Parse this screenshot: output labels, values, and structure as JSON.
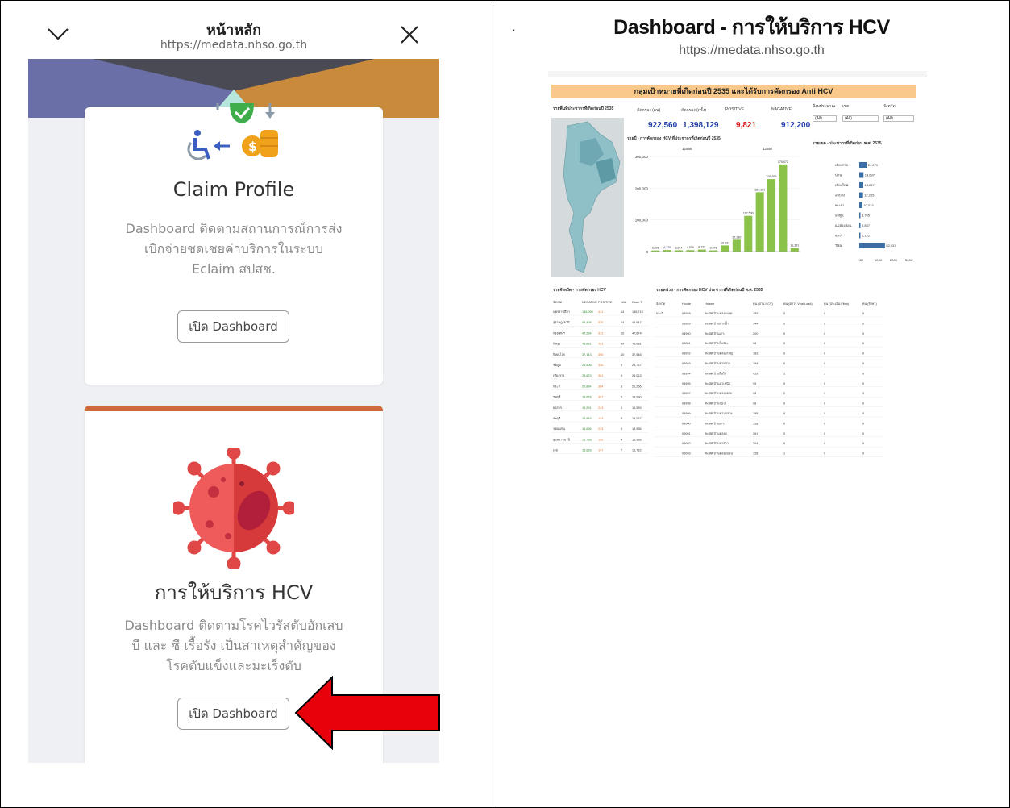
{
  "mobile": {
    "title": "หน้าหลัก",
    "url": "https://medata.nhso.go.th",
    "card1": {
      "title": "Claim Profile",
      "desc_lines": [
        "Dashboard ติดตามสถานการณ์การส่ง",
        "เบิกจ่ายชดเชยค่าบริการในระบบ",
        "Eclaim สปสช."
      ],
      "button": "เปิด Dashboard"
    },
    "card2": {
      "title": "การให้บริการ HCV",
      "desc_lines": [
        "Dashboard ติดตามโรคไวรัสตับอักเสบ",
        "บี และ ซี เรื้อรัง เป็นสาเหตุสำคัญของ",
        "โรคตับแข็งและมะเร็งตับ"
      ],
      "button": "เปิด Dashboard"
    }
  },
  "dashboard": {
    "title": "Dashboard - การให้บริการ HCV",
    "url": "https://medata.nhso.go.th",
    "banner": "กลุ่มเป้าหมายที่เกิดก่อนปี 2535 และได้รับการคัดกรอง Anti HCV",
    "kpi_labels": [
      "คัดกรอง (คน)",
      "คัดกรอง (ครั้ง)",
      "POSITIVE",
      "NAGATIVE"
    ],
    "kpi_values": [
      "922,560",
      "1,398,129",
      "9,821",
      "912,200"
    ],
    "kpi_colors": [
      "#1f3aa8",
      "#1f3aa8",
      "#d11a1a",
      "#1f3aa8"
    ],
    "map_title": "รายพื้นที่ประชากรที่เกิดก่อนปี 2535",
    "chart_title": "รายปี - การคัดกรอง HCV ที่ประชากรที่เกิดก่อนปี 2535",
    "chart_group_labels": [
      "12566",
      "12567"
    ],
    "chart_yticks": [
      "300,000",
      "200,000",
      "100,000",
      "0"
    ],
    "chart_bar_labels": [
      "3,396",
      "4,770",
      "3,964",
      "4,516",
      "6,122",
      "3,876",
      "19,337",
      "37,280",
      "112,590",
      "187,191",
      "228,565",
      "275,072",
      "11,331"
    ],
    "chart_bar_values": [
      3396,
      4770,
      3964,
      4516,
      6122,
      3876,
      19337,
      37280,
      112590,
      187191,
      228565,
      275072,
      11331
    ],
    "right_title": "รายเขต - ประชากรที่เกิดก่อน พ.ศ. 2535",
    "right_rows": [
      "เชียงราย",
      "น่าน",
      "เชียงใหม่",
      "ลำปาง",
      "พะเยา",
      "ลำพูน",
      "แม่ฮ่องสอน",
      "แพร่",
      "Total"
    ],
    "right_values": [
      "24,079",
      "13,697",
      "13,017",
      "12,215",
      "10,013",
      "3,765",
      "3,837",
      "2,116",
      "82,937"
    ],
    "right_fracs": [
      0.29,
      0.165,
      0.157,
      0.147,
      0.12,
      0.045,
      0.046,
      0.026,
      1.0
    ],
    "right_axis": [
      "0K",
      "100K",
      "200K",
      "300K"
    ],
    "filter_labels": [
      "ปีงบประมาณ",
      "เขต",
      "จังหวัด"
    ],
    "filter_value": "(All)",
    "left_table_title": "รายจังหวัด - การคัดกรอง HCV",
    "left_table_headers": [
      "จังหวัด",
      "NEGATIVE",
      "POSITIVE",
      "N/A",
      "Gran. T"
    ],
    "left_table_rows": [
      [
        "นครราชสีมา",
        "136,050",
        "411",
        "14",
        "136,715"
      ],
      [
        "สุราษฎร์ธานี",
        "49,408",
        "525",
        "14",
        "49,947"
      ],
      [
        "กรุงเทพฯ",
        "47,284",
        "312",
        "10",
        "47,674"
      ],
      [
        "พัทลุง",
        "45,581",
        "423",
        "27",
        "46,031"
      ],
      [
        "พิษณุโลก",
        "37,143",
        "396",
        "10",
        "37,546"
      ],
      [
        "ชัยภูมิ",
        "24,508",
        "326",
        "5",
        "24,767"
      ],
      [
        "เชียงราย",
        "23,623",
        "382",
        "9",
        "24,013"
      ],
      [
        "กระบี่",
        "20,884",
        "364",
        "8",
        "21,256"
      ],
      [
        "ชลบุรี",
        "19,678",
        "307",
        "5",
        "19,990"
      ],
      [
        "ยโสธร",
        "19,291",
        "243",
        "5",
        "19,539"
      ],
      [
        "ลพบุรี",
        "18,849",
        "139",
        "9",
        "19,067"
      ],
      [
        "ขอนแก่น",
        "18,696",
        "235",
        "5",
        "18,936"
      ],
      [
        "อุบลราชธานี",
        "15,738",
        "196",
        "4",
        "15,938"
      ],
      [
        "เลย",
        "15,628",
        "147",
        "7",
        "15,782"
      ]
    ],
    "right_table_title": "รายหน่วย - การคัดกรอง HCV ประชากรที่เกิดก่อนปี พ.ศ. 2535",
    "right_table_headers": [
      "จังหวัด",
      "Hcode",
      "Hname",
      "คน (ผ่าน HCV)",
      "คน (ตรวจ Viral Load)",
      "คน (ประเมิน Fibro)",
      "คน (รักษา)"
    ],
    "right_table_rows": [
      [
        "กระบี่",
        "08988",
        "รพ.สต.บ้านคลองแรด",
        "185",
        "0",
        "0",
        "0"
      ],
      [
        "",
        "08989",
        "รพ.สต.บ้านปากน้ำ",
        "144",
        "0",
        "0",
        "0"
      ],
      [
        "",
        "08990",
        "รพ.สต.บ้านเกาะ",
        "200",
        "0",
        "0",
        "0"
      ],
      [
        "",
        "08991",
        "รพ.สต.บ้านในสระ",
        "98",
        "0",
        "0",
        "0"
      ],
      [
        "",
        "08992",
        "รพ.สต.บ้านคลองใหญ่",
        "183",
        "0",
        "0",
        "0"
      ],
      [
        "",
        "08993",
        "รพ.สต.บ้านท้ายสวน",
        "194",
        "0",
        "0",
        "0"
      ],
      [
        "",
        "08994",
        "รพ.สต.บ้านในไร่",
        "429",
        "1",
        "1",
        "0"
      ],
      [
        "",
        "08995",
        "รพ.สต.บ้านนาเหนือ",
        "95",
        "0",
        "0",
        "0"
      ],
      [
        "",
        "08997",
        "รพ.สต.บ้านคลองยวน",
        "58",
        "0",
        "0",
        "0"
      ],
      [
        "",
        "08998",
        "รพ.สต.บ้านในไร่",
        "98",
        "0",
        "0",
        "0"
      ],
      [
        "",
        "08999",
        "รพ.สต.บ้านควนกลาง",
        "195",
        "0",
        "0",
        "0"
      ],
      [
        "",
        "09000",
        "รพ.สต.บ้านเกาะ",
        "158",
        "0",
        "0",
        "0"
      ],
      [
        "",
        "09001",
        "รพ.สต.บ้านคลอง",
        "261",
        "0",
        "0",
        "0"
      ],
      [
        "",
        "09002",
        "รพ.สต.บ้านท่าอ่าว",
        "204",
        "0",
        "0",
        "0"
      ],
      [
        "",
        "09003",
        "รพ.สต.บ้านคลองบอน",
        "128",
        "1",
        "0",
        "0"
      ]
    ]
  },
  "colors": {
    "accent_orange": "#cf6a3c",
    "arrow_red": "#e8000b",
    "bar_green": "#8bc34a",
    "bar_blue": "#3b6ea5"
  }
}
